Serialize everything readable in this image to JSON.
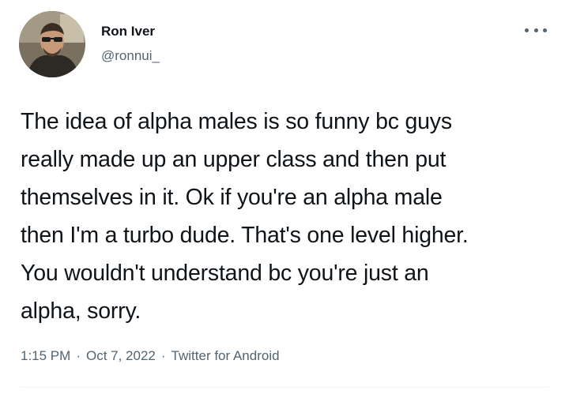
{
  "author": {
    "display_name": "Ron Iver",
    "handle": "@ronnui_",
    "avatar_icon": "profile-photo"
  },
  "menu": {
    "icon": "more-horizontal-icon"
  },
  "tweet": {
    "lines": [
      "The idea of alpha males is so funny bc guys",
      "really made up an upper class and then put",
      "themselves in it. Ok if you're an alpha male",
      "then I'm a turbo dude. That's one level higher.",
      "You wouldn't understand bc you're just an",
      "alpha, sorry."
    ]
  },
  "meta": {
    "time": "1:15 PM",
    "separator": "·",
    "date": "Oct 7, 2022",
    "source": "Twitter for Android"
  },
  "colors": {
    "text": "#0f1419",
    "secondary": "#536471",
    "divider": "#eff3f4"
  }
}
